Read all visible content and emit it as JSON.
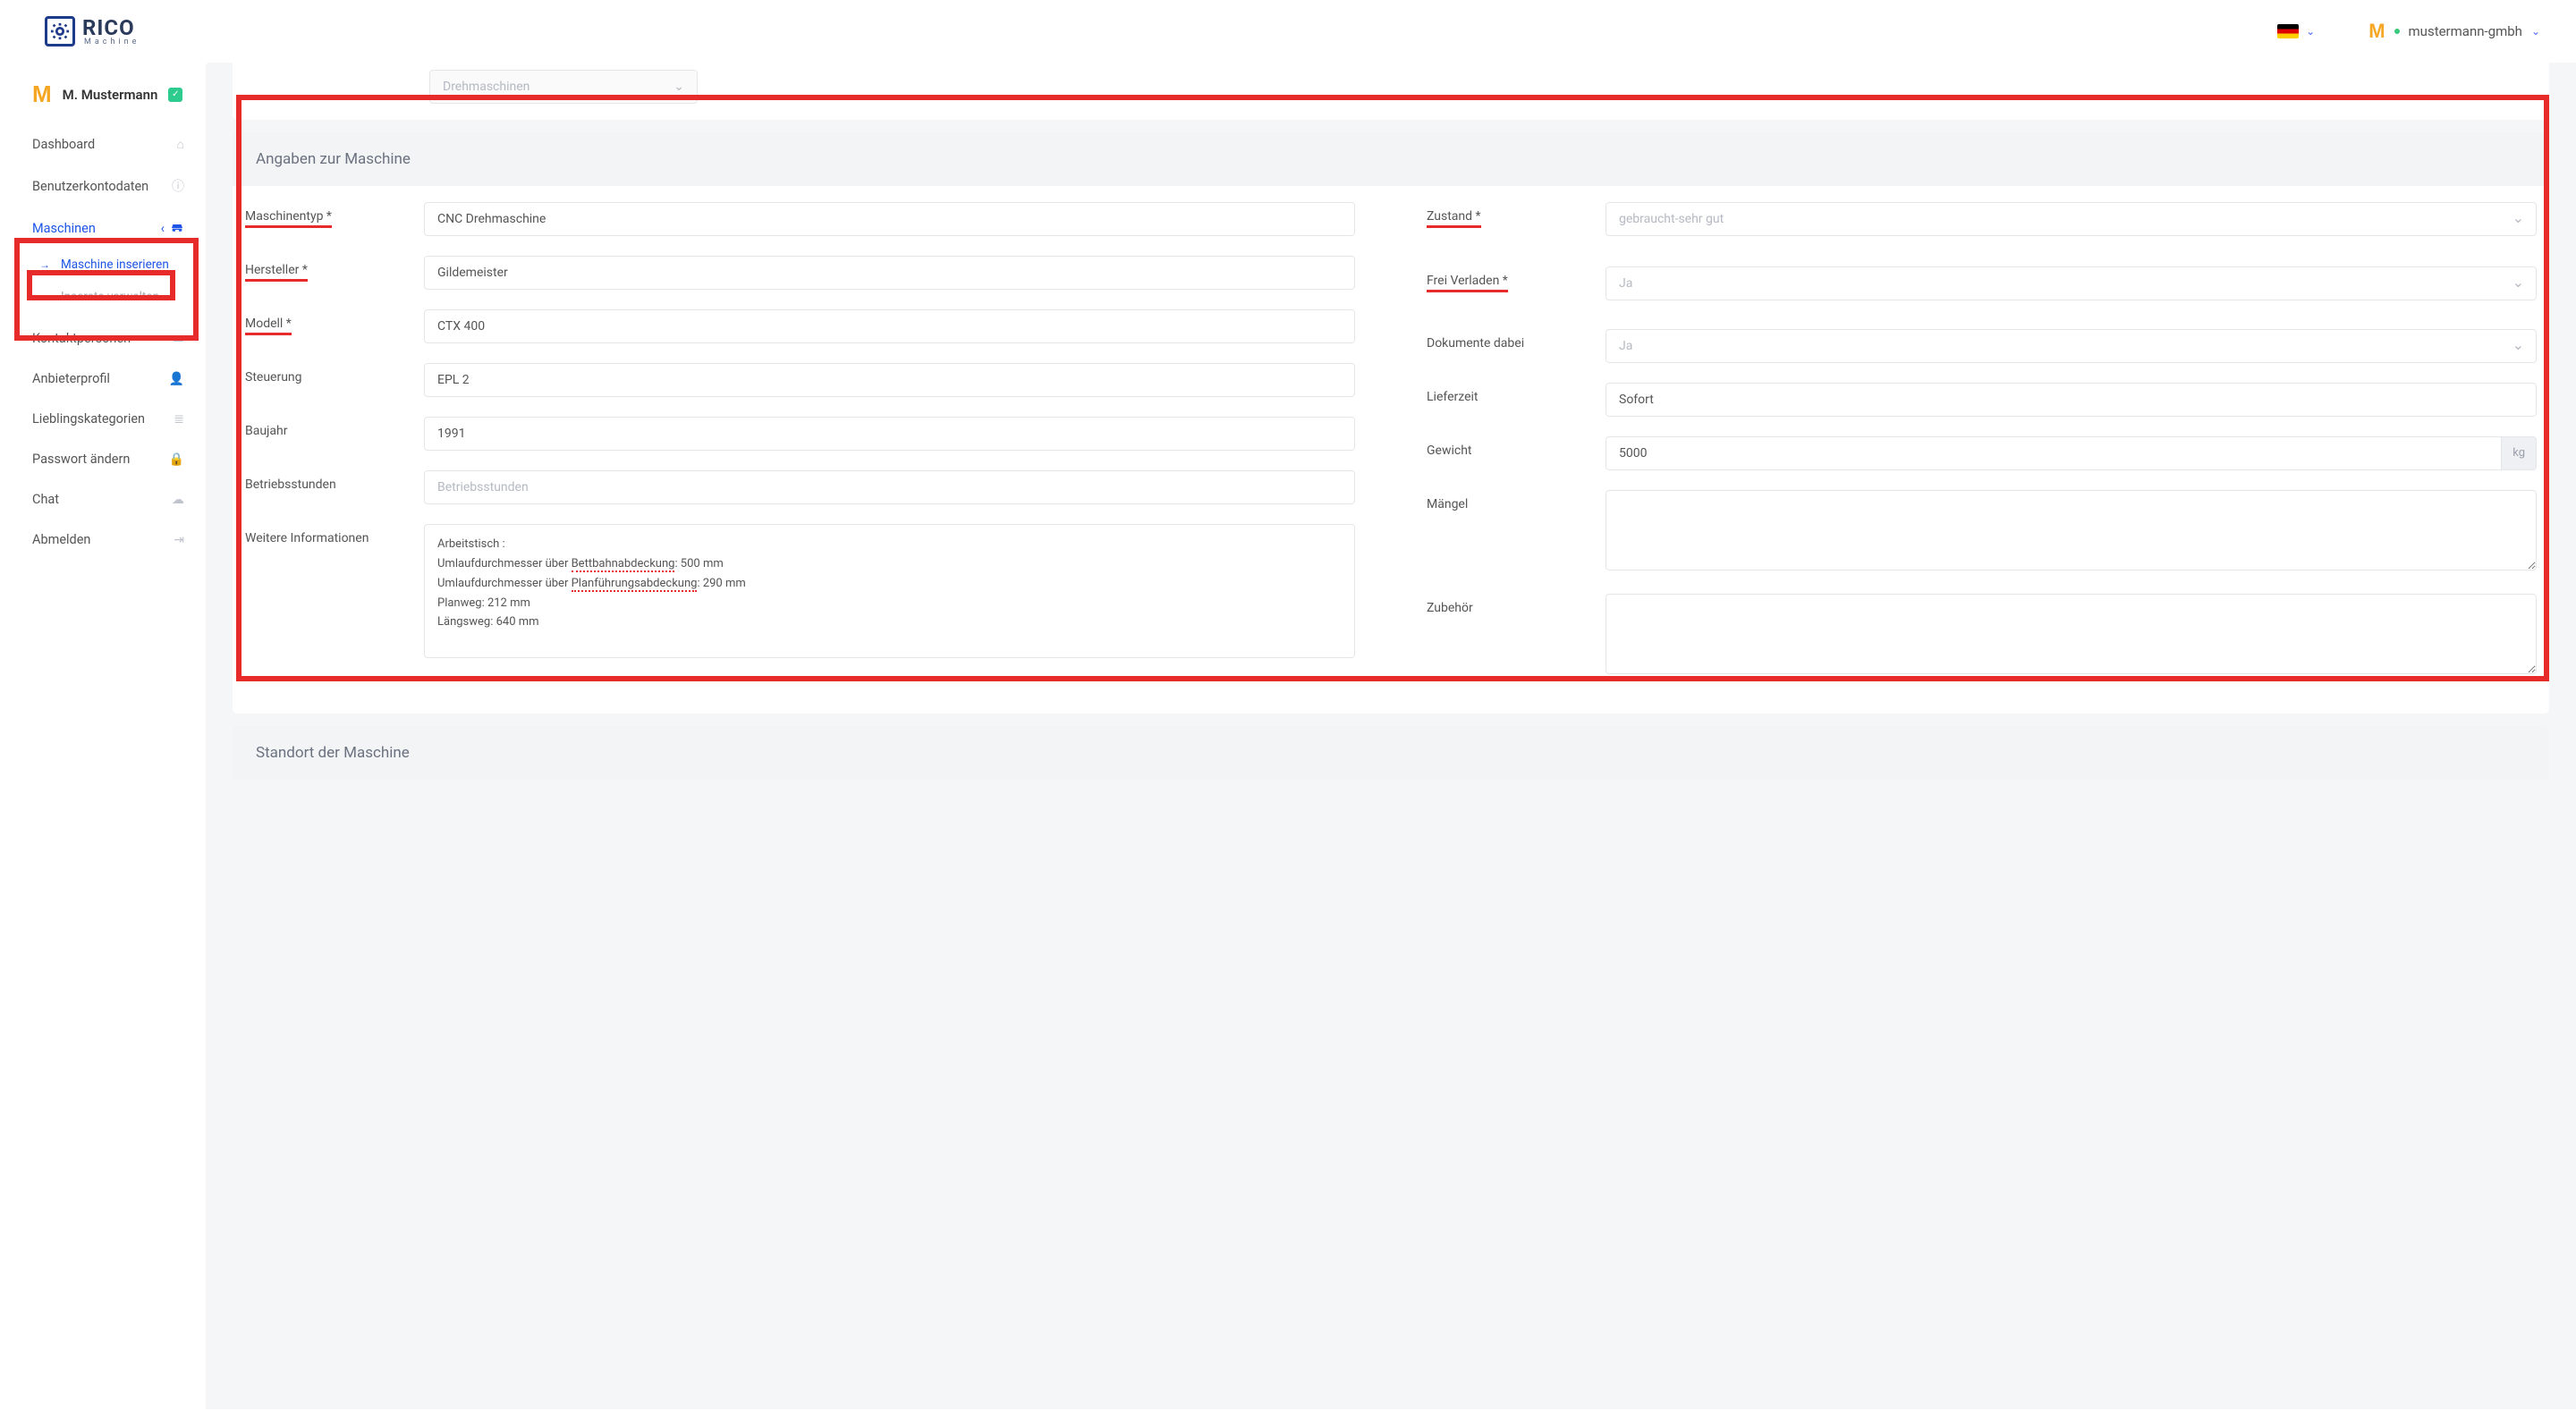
{
  "header": {
    "logo_main": "RICO",
    "logo_sub": "Machine",
    "org_name": "mustermann-gmbh"
  },
  "sidebar": {
    "user_name": "M. Mustermann",
    "items": [
      {
        "label": "Dashboard",
        "icon": "⌂"
      },
      {
        "label": "Benutzerkontodaten",
        "icon": "ⓘ"
      },
      {
        "label": "Maschinen",
        "icon": "🚗",
        "chevron": "‹"
      },
      {
        "label": "Kontaktpersonen",
        "icon": "▭"
      },
      {
        "label": "Anbieterprofil",
        "icon": "👤"
      },
      {
        "label": "Lieblingskategorien",
        "icon": "≣"
      },
      {
        "label": "Passwort ändern",
        "icon": "🔒"
      },
      {
        "label": "Chat",
        "icon": "☁"
      },
      {
        "label": "Abmelden",
        "icon": "⇥"
      }
    ],
    "sub_items": [
      {
        "label": "Maschine inserieren"
      },
      {
        "label": "Inserate verwalten"
      }
    ]
  },
  "top_select": {
    "value": "Drehmaschinen"
  },
  "section1_title": "Angaben zur Maschine",
  "section2_title": "Standort der Maschine",
  "form": {
    "left": [
      {
        "label": "Maschinentyp *",
        "value": "CNC Drehmaschine",
        "req": true
      },
      {
        "label": "Hersteller *",
        "value": "Gildemeister",
        "req": true
      },
      {
        "label": "Modell *",
        "value": "CTX 400",
        "req": true
      },
      {
        "label": "Steuerung",
        "value": "EPL 2"
      },
      {
        "label": "Baujahr",
        "value": "1991"
      },
      {
        "label": "Betriebsstunden",
        "value": "",
        "placeholder": "Betriebsstunden"
      },
      {
        "label": "Weitere Informationen"
      }
    ],
    "rte_lines": [
      "Arbeitstisch :",
      "Umlaufdurchmesser über Bettbahnabdeckung: 500 mm",
      "Umlaufdurchmesser über Planführungsabdeckung: 290 mm",
      "Planweg: 212 mm",
      "Längsweg: 640 mm"
    ],
    "right": [
      {
        "label": "Zustand *",
        "type": "select",
        "value": "gebraucht-sehr gut",
        "req": true
      },
      {
        "label": "Frei Verladen *",
        "type": "select",
        "value": "Ja",
        "req": true
      },
      {
        "label": "Dokumente dabei",
        "type": "select",
        "value": "Ja"
      },
      {
        "label": "Lieferzeit",
        "type": "input",
        "value": "Sofort"
      },
      {
        "label": "Gewicht",
        "type": "input-addon",
        "value": "5000",
        "addon": "kg"
      },
      {
        "label": "Mängel",
        "type": "textarea"
      },
      {
        "label": "Zubehör",
        "type": "textarea"
      }
    ]
  }
}
